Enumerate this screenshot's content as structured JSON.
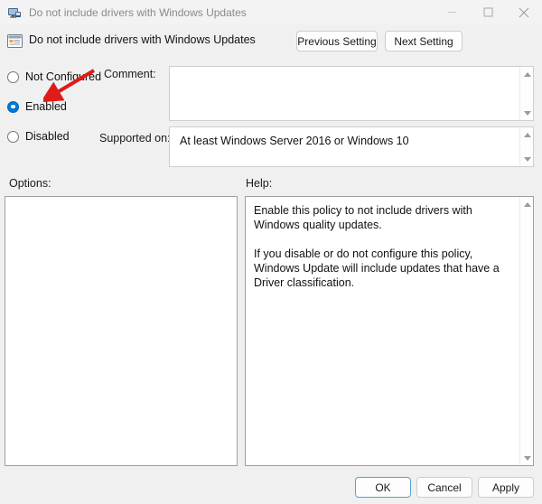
{
  "window": {
    "title": "Do not include drivers with Windows Updates",
    "icon": "policy-monitor-icon",
    "controls": {
      "minimize": "minimize-icon",
      "maximize": "maximize-icon",
      "close": "close-icon"
    }
  },
  "header": {
    "policy_icon": "group-policy-setting-icon",
    "policy_title": "Do not include drivers with Windows Updates",
    "previous_setting_label": "Previous Setting",
    "next_setting_label": "Next Setting"
  },
  "state": {
    "options": [
      {
        "label": "Not Configured",
        "selected": false
      },
      {
        "label": "Enabled",
        "selected": true
      },
      {
        "label": "Disabled",
        "selected": false
      }
    ],
    "selected_value": "Enabled"
  },
  "comment": {
    "label": "Comment:",
    "value": ""
  },
  "supported": {
    "label": "Supported on:",
    "value": "At least Windows Server 2016 or Windows 10"
  },
  "sections": {
    "options_label": "Options:",
    "help_label": "Help:",
    "options_content": "",
    "help_paragraphs": [
      "Enable this policy to not include drivers with Windows quality updates.",
      "If you disable or do not configure this policy, Windows Update will include updates that have a Driver classification."
    ]
  },
  "footer": {
    "ok_label": "OK",
    "cancel_label": "Cancel",
    "apply_label": "Apply"
  },
  "annotation": {
    "type": "red-arrow",
    "points_to": "Enabled",
    "color": "#e01b1b"
  },
  "colors": {
    "background": "#f0f0f0",
    "titlebar": "#f3f3f3",
    "accent": "#0078d4",
    "panel_border": "#a0a0a0",
    "field_border": "#cfcfcf",
    "annotation_red": "#e01b1b"
  }
}
